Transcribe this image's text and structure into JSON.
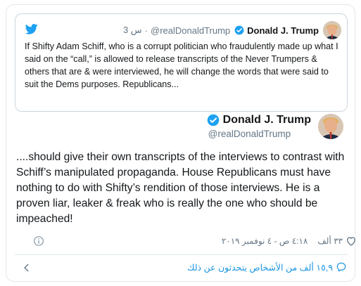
{
  "quoted_tweet": {
    "author_name": "Donald J. Trump",
    "handle": "@realDonaldTrump",
    "time": "3 س",
    "separator": "·",
    "text": "If Shifty Adam Schiff, who is a corrupt politician who fraudulently made up what I said on the “call,” is allowed to release transcripts of the Never Trumpers & others that are & were interviewed, he will change the words that were said to suit the Dems purposes. Republicans..."
  },
  "tweet": {
    "author_name": "Donald J. Trump",
    "handle": "@realDonaldTrump",
    "text": "....should give their own transcripts of the interviews to contrast with Schiff’s manipulated propaganda. House Republicans must have nothing to do with Shifty’s rendition of those interviews. He is a proven liar, leaker & freak who is really the one who should be impeached!",
    "likes": "٣٣ ألف",
    "timestamp": "٤:١٨ ص - ٤ نوفمبر ٢٠١٩"
  },
  "footer": {
    "people_talking": "١٥,٩ ألف من الأشخاص يتحدثون عن ذلك"
  },
  "colors": {
    "twitter_blue": "#1da1f2",
    "link_blue": "#1b95e0",
    "muted": "#657786",
    "border": "#e1e8ed"
  },
  "icons": [
    "twitter-bird-icon",
    "verified-badge-icon",
    "heart-icon",
    "info-icon",
    "chevron-left-icon",
    "speech-bubble-icon"
  ]
}
